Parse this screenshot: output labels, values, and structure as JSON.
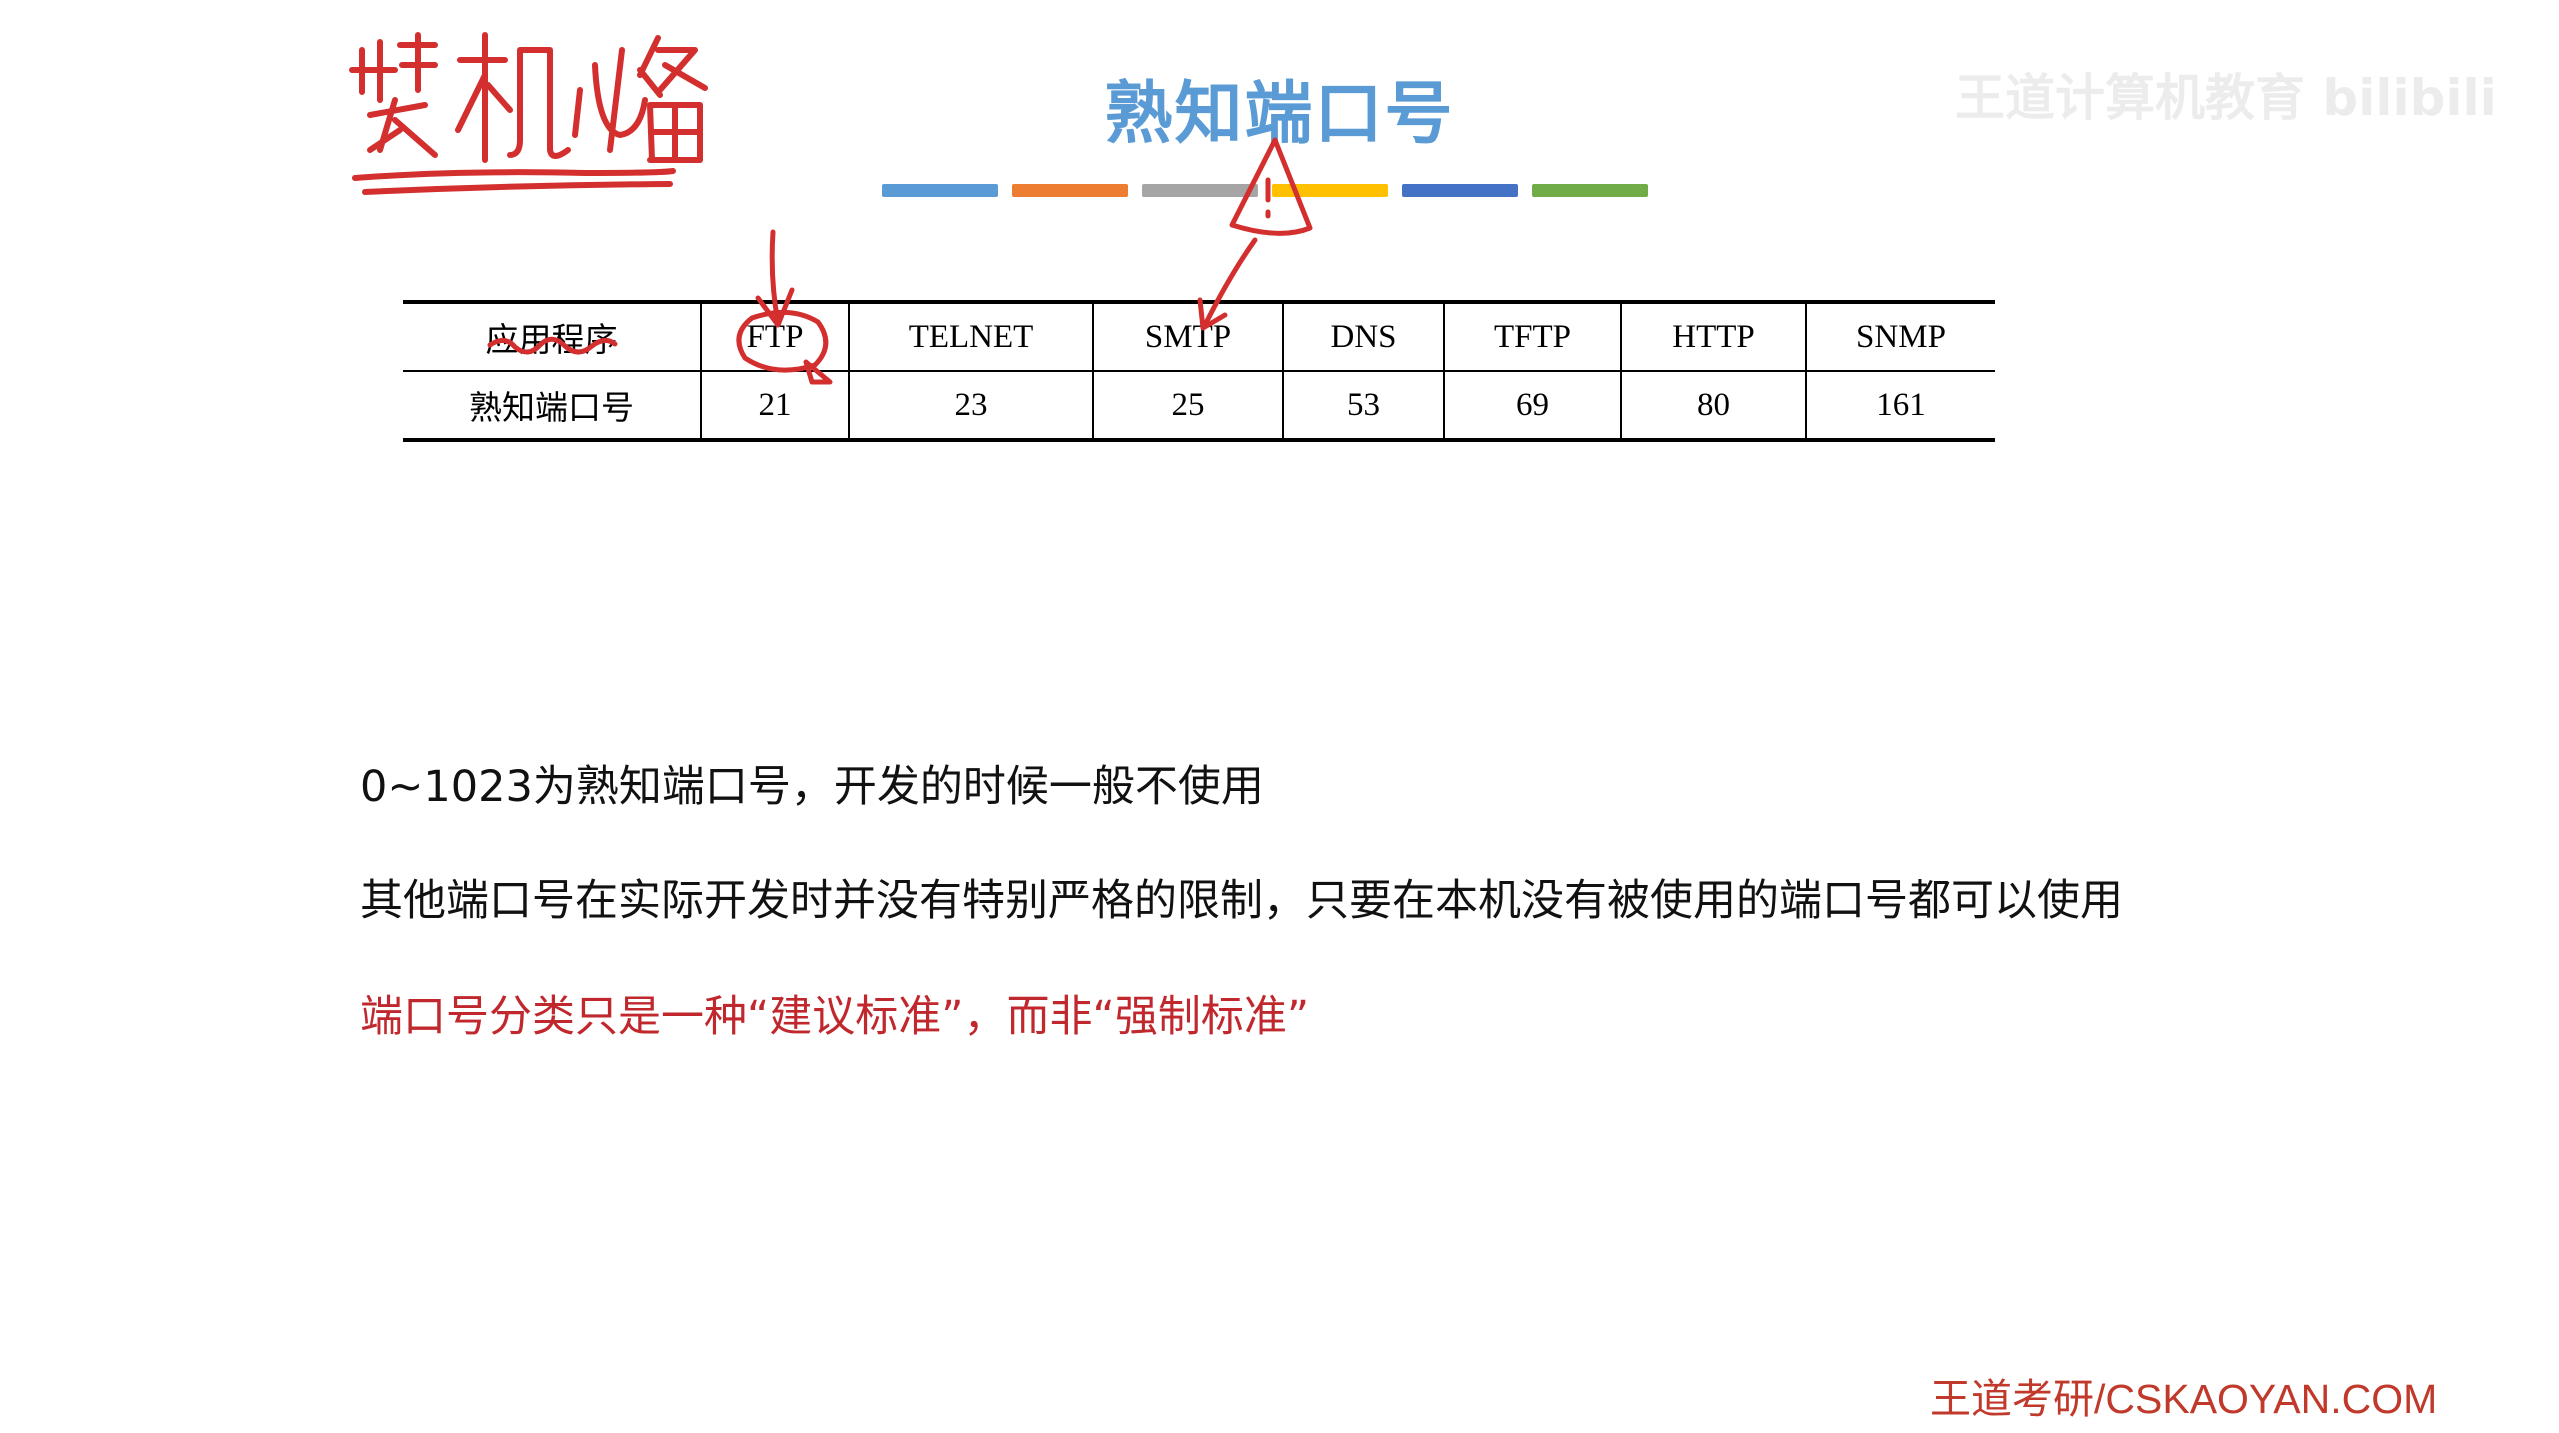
{
  "slide": {
    "title": "熟知端口号",
    "handwritten_note": "装机必备",
    "watermark": "王道计算机教育 bilibili"
  },
  "color_bars": [
    "#5b9bd5",
    "#ed7d31",
    "#a5a5a5",
    "#ffc000",
    "#4472c4",
    "#70ad47"
  ],
  "port_table": {
    "row_labels": [
      "应用程序",
      "熟知端口号"
    ],
    "applications": [
      "FTP",
      "TELNET",
      "SMTP",
      "DNS",
      "TFTP",
      "HTTP",
      "SNMP"
    ],
    "ports": [
      "21",
      "23",
      "25",
      "53",
      "69",
      "80",
      "161"
    ]
  },
  "notes": {
    "line1": "0~1023为熟知端口号，开发的时候一般不使用",
    "line2": "其他端口号在实际开发时并没有特别严格的限制，只要在本机没有被使用的端口号都可以使用",
    "line3": "端口号分类只是一种“建议标准”，而非“强制标准”"
  },
  "footer": {
    "brand": "王道考研/CSKAOYAN.COM"
  },
  "colors": {
    "title_blue": "#5b9bd5",
    "annotation_red": "#d32f2f",
    "highlight_red": "#c0282e",
    "footer_red": "#c0392b"
  }
}
